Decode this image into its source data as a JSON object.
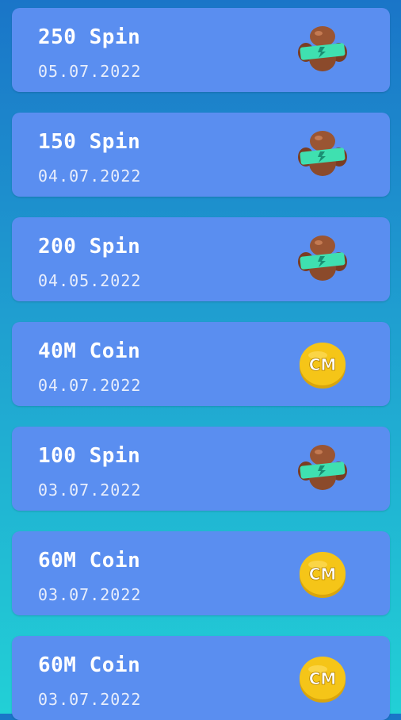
{
  "rewards": [
    {
      "title": "250 Spin",
      "date": "05.07.2022",
      "icon": "spin-icon"
    },
    {
      "title": "150 Spin",
      "date": "04.07.2022",
      "icon": "spin-icon"
    },
    {
      "title": "200 Spin",
      "date": "04.05.2022",
      "icon": "spin-icon"
    },
    {
      "title": "40M Coin",
      "date": "04.07.2022",
      "icon": "coin-icon"
    },
    {
      "title": "100 Spin",
      "date": "03.07.2022",
      "icon": "spin-icon"
    },
    {
      "title": "60M Coin",
      "date": "03.07.2022",
      "icon": "coin-icon"
    },
    {
      "title": "60M Coin",
      "date": "03.07.2022",
      "icon": "coin-icon"
    }
  ],
  "coin_label": "CM",
  "colors": {
    "card": "#5a8ef0",
    "coin": "#f5c518",
    "spin_brown": "#8b4a2b",
    "spin_green": "#3fe0b0"
  }
}
